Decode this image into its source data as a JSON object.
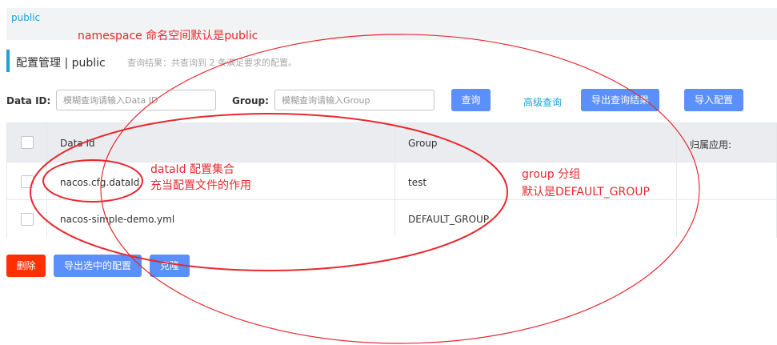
{
  "namespace_tab": "public",
  "page": {
    "title": "配置管理 | public",
    "query_result": "查询结果：共查询到 2 条满足要求的配置。"
  },
  "search": {
    "dataid_label": "Data ID:",
    "dataid_placeholder": "模糊查询请输入Data ID",
    "group_label": "Group:",
    "group_placeholder": "模糊查询请输入Group",
    "query_button": "查询",
    "advanced_query": "高级查询",
    "export_results_button": "导出查询结果",
    "import_button": "导入配置"
  },
  "table": {
    "columns": [
      "Data Id",
      "Group",
      "归属应用:"
    ],
    "rows": [
      {
        "data_id": "nacos.cfg.dataId",
        "group": "test",
        "app": ""
      },
      {
        "data_id": "nacos-simple-demo.yml",
        "group": "DEFAULT_GROUP",
        "app": ""
      }
    ]
  },
  "bottom_actions": {
    "delete_button": "删除",
    "export_selected_button": "导出选中的配置",
    "clone_button": "克隆"
  },
  "annotations": {
    "namespace": "namespace 命名空间默认是public",
    "dataid_line1": "dataId 配置集合",
    "dataid_line2": "充当配置文件的作用",
    "group_line1": "group 分组",
    "group_line2": "默认是DEFAULT_GROUP"
  },
  "colors": {
    "accent": "#1aa2d4",
    "primary_button": "#5b8ff9",
    "danger_button": "#ff3000",
    "annotation_red": "#e8282e"
  }
}
